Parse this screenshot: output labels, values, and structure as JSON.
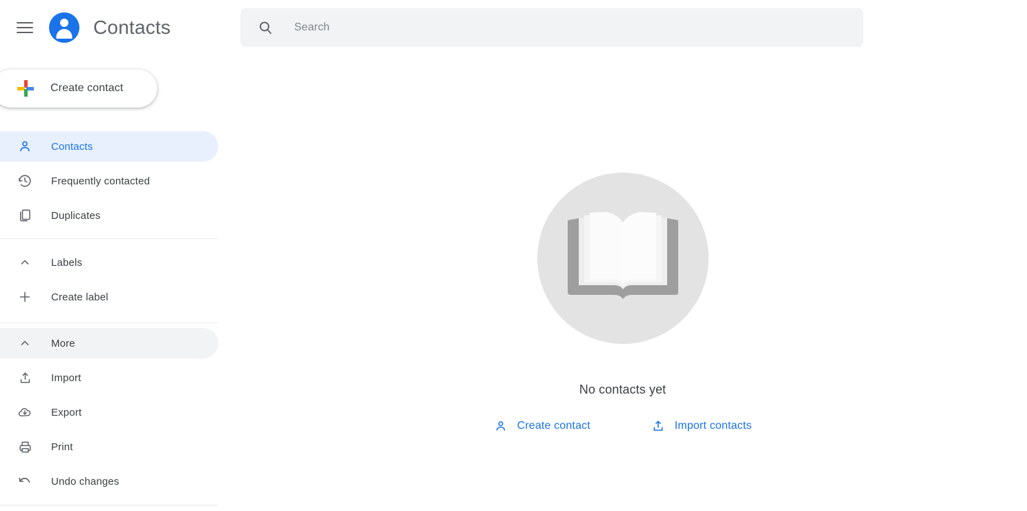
{
  "app": {
    "title": "Contacts",
    "accent_color": "#1a73e8",
    "active_pill_color": "#e8f0fe",
    "hover_pill_color": "#f1f3f4",
    "text_color": "#3c4043",
    "icon_color": "#5f6368"
  },
  "header": {
    "menu_icon": "hamburger-menu-icon",
    "avatar_icon": "contacts-person-avatar-icon",
    "title": "Contacts"
  },
  "create_button": {
    "label": "Create contact",
    "icon": "google-plus-icon",
    "plus_colors": {
      "top": "#ea4335",
      "left": "#fbbc04",
      "right": "#4285f4",
      "bottom": "#34a853"
    }
  },
  "sidebar": {
    "main_items": [
      {
        "label": "Contacts",
        "icon": "person-outline-icon",
        "active": true,
        "hovered": false
      },
      {
        "label": "Frequently contacted",
        "icon": "history-clock-icon",
        "active": false,
        "hovered": false
      },
      {
        "label": "Duplicates",
        "icon": "duplicate-pages-icon",
        "active": false,
        "hovered": false
      }
    ],
    "label_items": [
      {
        "label": "Labels",
        "icon": "chevron-up-icon",
        "active": false,
        "hovered": false
      },
      {
        "label": "Create label",
        "icon": "plus-icon",
        "active": false,
        "hovered": false
      }
    ],
    "more_items": [
      {
        "label": "More",
        "icon": "chevron-up-icon",
        "active": false,
        "hovered": true
      },
      {
        "label": "Import",
        "icon": "import-upload-icon",
        "active": false,
        "hovered": false
      },
      {
        "label": "Export",
        "icon": "export-cloud-download-icon",
        "active": false,
        "hovered": false
      },
      {
        "label": "Print",
        "icon": "printer-icon",
        "active": false,
        "hovered": false
      },
      {
        "label": "Undo changes",
        "icon": "undo-arrow-icon",
        "active": false,
        "hovered": false
      }
    ]
  },
  "search": {
    "placeholder": "Search",
    "value": "",
    "icon": "search-magnifier-icon"
  },
  "empty_state": {
    "illustration": "open-book-illustration",
    "circle_color": "#e3e3e3",
    "title": "No contacts yet",
    "actions": [
      {
        "label": "Create contact",
        "icon": "person-add-outline-icon"
      },
      {
        "label": "Import contacts",
        "icon": "import-upload-icon"
      }
    ]
  }
}
